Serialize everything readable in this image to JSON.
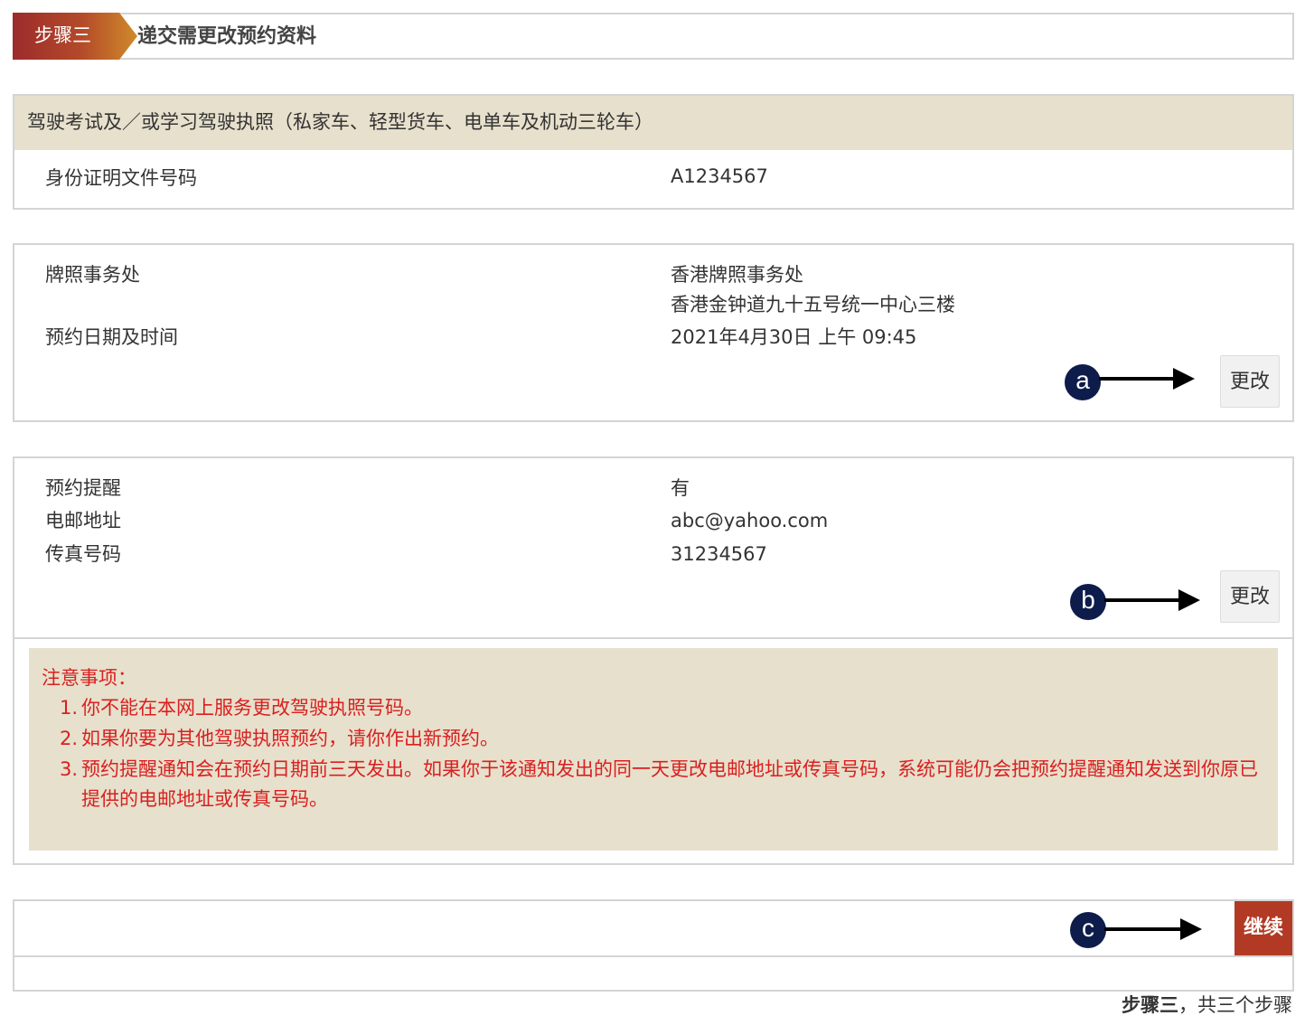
{
  "step": {
    "badge": "步骤三",
    "title": "递交需更改预约资料"
  },
  "licence": {
    "type": "驾驶考试及／或学习驾驶执照（私家车、轻型货车、电单车及机动三轮车）",
    "id_label": "身份证明文件号码",
    "id_value": "A1234567"
  },
  "appointment": {
    "office_label": "牌照事务处",
    "office_name": "香港牌照事务处",
    "office_address": "香港金钟道九十五号统一中心三楼",
    "datetime_label": "预约日期及时间",
    "datetime_value": "2021年4月30日 上午 09:45",
    "change_label": "更改",
    "marker": "a"
  },
  "reminder": {
    "reminder_label": "预约提醒",
    "reminder_value": "有",
    "email_label": "电邮地址",
    "email_value": "abc@yahoo.com",
    "fax_label": "传真号码",
    "fax_value": "31234567",
    "change_label": "更改",
    "marker": "b"
  },
  "notice": {
    "title": "注意事项：",
    "items": [
      {
        "num": "1.",
        "text": "你不能在本网上服务更改驾驶执照号码。"
      },
      {
        "num": "2.",
        "text": "如果你要为其他驾驶执照预约，请你作出新预约。"
      },
      {
        "num": "3.",
        "text": "预约提醒通知会在预约日期前三天发出。如果你于该通知发出的同一天更改电邮地址或传真号码，系统可能仍会把预约提醒通知发送到你原已提供的电邮地址或传真号码。"
      }
    ]
  },
  "actions": {
    "continue_label": "继续",
    "marker": "c"
  },
  "footer": {
    "step_current": "步骤三",
    "step_total": "，共三个步骤"
  },
  "colors": {
    "accent": "#b23a24",
    "notice_bg": "#e7e0cc",
    "notice_text": "#d92020",
    "marker_bg": "#0d1c4a"
  }
}
